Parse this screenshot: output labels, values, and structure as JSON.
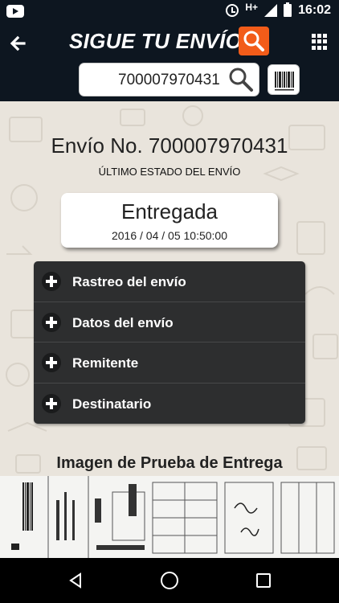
{
  "status_bar": {
    "network_label": "H+",
    "time": "16:02",
    "icons": [
      "youtube-icon",
      "alarm-icon",
      "signal-icon",
      "battery-icon"
    ]
  },
  "header": {
    "title": "SIGUE TU ENVÍO",
    "icons": [
      "back-arrow-icon",
      "search-icon",
      "grid-menu-icon"
    ]
  },
  "search": {
    "value": "700007970431",
    "icons": [
      "magnifier-icon",
      "barcode-icon"
    ]
  },
  "shipment": {
    "title": "Envío No. 700007970431",
    "last_status_label": "ÚLTIMO ESTADO DEL ENVÍO",
    "status": "Entregada",
    "status_datetime": "2016 / 04 / 05 10:50:00"
  },
  "accordion": {
    "items": [
      {
        "label": "Rastreo del envío"
      },
      {
        "label": "Datos del envío"
      },
      {
        "label": "Remitente"
      },
      {
        "label": "Destinatario"
      }
    ]
  },
  "proof": {
    "title": "Imagen de Prueba de Entrega"
  },
  "nav": {
    "icons": [
      "nav-back-icon",
      "nav-home-icon",
      "nav-recent-icon"
    ]
  },
  "colors": {
    "dark": "#0d1620",
    "accent": "#f25c19",
    "panel": "#2d2e2f",
    "background": "#e9e4dc"
  }
}
